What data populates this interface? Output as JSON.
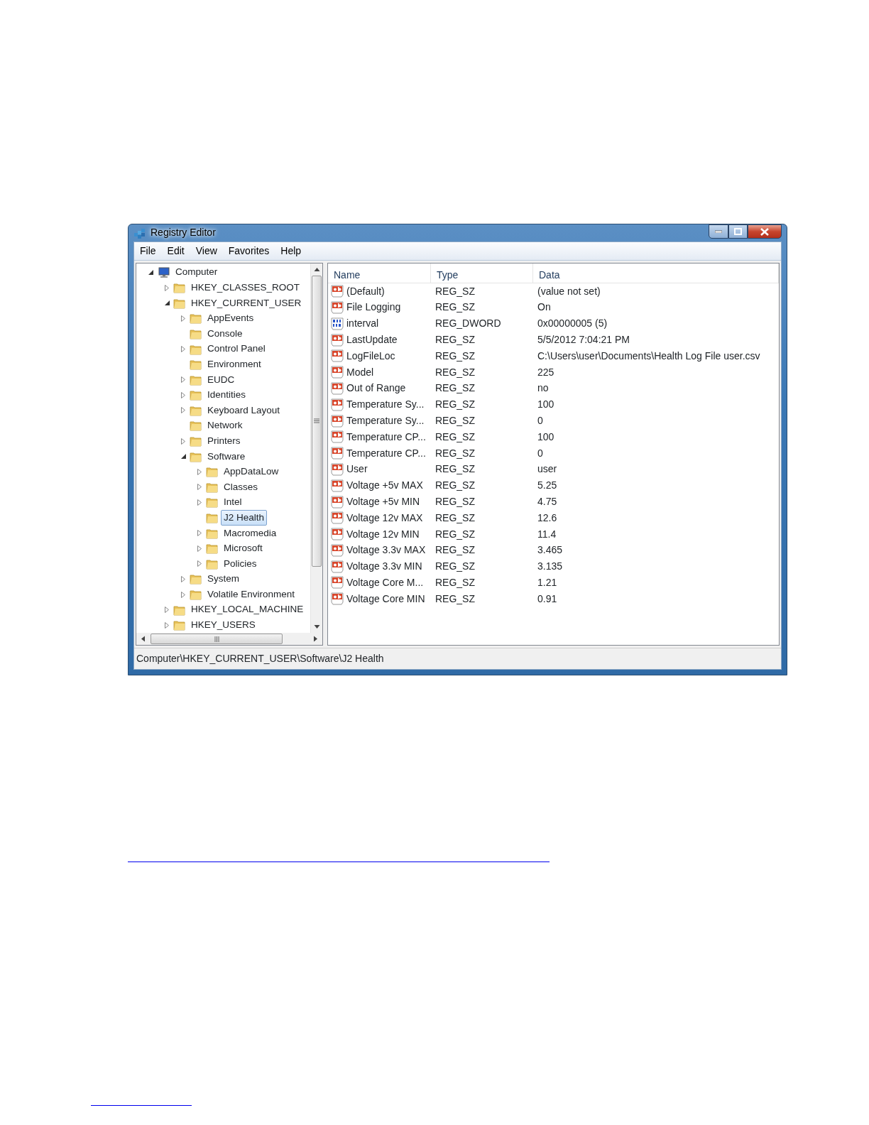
{
  "window": {
    "title": "Registry Editor"
  },
  "menu": [
    "File",
    "Edit",
    "View",
    "Favorites",
    "Help"
  ],
  "tree": [
    {
      "label": "Computer",
      "kind": "computer",
      "expandable": true,
      "expanded": true,
      "selected": false,
      "children": [
        {
          "label": "HKEY_CLASSES_ROOT",
          "expandable": true,
          "expanded": false,
          "selected": false
        },
        {
          "label": "HKEY_CURRENT_USER",
          "expandable": true,
          "expanded": true,
          "selected": false,
          "children": [
            {
              "label": "AppEvents",
              "expandable": true,
              "expanded": false,
              "selected": false
            },
            {
              "label": "Console",
              "expandable": false,
              "expanded": false,
              "selected": false
            },
            {
              "label": "Control Panel",
              "expandable": true,
              "expanded": false,
              "selected": false
            },
            {
              "label": "Environment",
              "expandable": false,
              "expanded": false,
              "selected": false
            },
            {
              "label": "EUDC",
              "expandable": true,
              "expanded": false,
              "selected": false
            },
            {
              "label": "Identities",
              "expandable": true,
              "expanded": false,
              "selected": false
            },
            {
              "label": "Keyboard Layout",
              "expandable": true,
              "expanded": false,
              "selected": false
            },
            {
              "label": "Network",
              "expandable": false,
              "expanded": false,
              "selected": false
            },
            {
              "label": "Printers",
              "expandable": true,
              "expanded": false,
              "selected": false
            },
            {
              "label": "Software",
              "expandable": true,
              "expanded": true,
              "selected": false,
              "children": [
                {
                  "label": "AppDataLow",
                  "expandable": true,
                  "expanded": false,
                  "selected": false
                },
                {
                  "label": "Classes",
                  "expandable": true,
                  "expanded": false,
                  "selected": false
                },
                {
                  "label": "Intel",
                  "expandable": true,
                  "expanded": false,
                  "selected": false
                },
                {
                  "label": "J2 Health",
                  "expandable": false,
                  "expanded": false,
                  "selected": true
                },
                {
                  "label": "Macromedia",
                  "expandable": true,
                  "expanded": false,
                  "selected": false
                },
                {
                  "label": "Microsoft",
                  "expandable": true,
                  "expanded": false,
                  "selected": false
                },
                {
                  "label": "Policies",
                  "expandable": true,
                  "expanded": false,
                  "selected": false
                }
              ]
            },
            {
              "label": "System",
              "expandable": true,
              "expanded": false,
              "selected": false
            },
            {
              "label": "Volatile Environment",
              "expandable": true,
              "expanded": false,
              "selected": false
            }
          ]
        },
        {
          "label": "HKEY_LOCAL_MACHINE",
          "expandable": true,
          "expanded": false,
          "selected": false
        },
        {
          "label": "HKEY_USERS",
          "expandable": true,
          "expanded": false,
          "selected": false
        }
      ]
    }
  ],
  "table": {
    "columns": [
      "Name",
      "Type",
      "Data"
    ],
    "rows": [
      {
        "kind": "string",
        "name": "(Default)",
        "type": "REG_SZ",
        "data": "(value not set)"
      },
      {
        "kind": "string",
        "name": "File Logging",
        "type": "REG_SZ",
        "data": "On"
      },
      {
        "kind": "dword",
        "name": "interval",
        "type": "REG_DWORD",
        "data": "0x00000005 (5)"
      },
      {
        "kind": "string",
        "name": "LastUpdate",
        "type": "REG_SZ",
        "data": "5/5/2012 7:04:21 PM"
      },
      {
        "kind": "string",
        "name": "LogFileLoc",
        "type": "REG_SZ",
        "data": "C:\\Users\\user\\Documents\\Health Log File user.csv"
      },
      {
        "kind": "string",
        "name": "Model",
        "type": "REG_SZ",
        "data": "225"
      },
      {
        "kind": "string",
        "name": "Out of Range",
        "type": "REG_SZ",
        "data": "no"
      },
      {
        "kind": "string",
        "name": "Temperature Sy...",
        "type": "REG_SZ",
        "data": "100"
      },
      {
        "kind": "string",
        "name": "Temperature Sy...",
        "type": "REG_SZ",
        "data": "0"
      },
      {
        "kind": "string",
        "name": "Temperature CP...",
        "type": "REG_SZ",
        "data": "100"
      },
      {
        "kind": "string",
        "name": "Temperature CP...",
        "type": "REG_SZ",
        "data": "0"
      },
      {
        "kind": "string",
        "name": "User",
        "type": "REG_SZ",
        "data": "user"
      },
      {
        "kind": "string",
        "name": "Voltage +5v MAX",
        "type": "REG_SZ",
        "data": "5.25"
      },
      {
        "kind": "string",
        "name": "Voltage +5v MIN",
        "type": "REG_SZ",
        "data": "4.75"
      },
      {
        "kind": "string",
        "name": "Voltage 12v MAX",
        "type": "REG_SZ",
        "data": "12.6"
      },
      {
        "kind": "string",
        "name": "Voltage 12v MIN",
        "type": "REG_SZ",
        "data": "11.4"
      },
      {
        "kind": "string",
        "name": "Voltage 3.3v MAX",
        "type": "REG_SZ",
        "data": "3.465"
      },
      {
        "kind": "string",
        "name": "Voltage 3.3v MIN",
        "type": "REG_SZ",
        "data": "3.135"
      },
      {
        "kind": "string",
        "name": "Voltage Core M...",
        "type": "REG_SZ",
        "data": "1.21"
      },
      {
        "kind": "string",
        "name": "Voltage Core MIN",
        "type": "REG_SZ",
        "data": "0.91"
      }
    ]
  },
  "status_bar": "Computer\\HKEY_CURRENT_USER\\Software\\J2 Health"
}
